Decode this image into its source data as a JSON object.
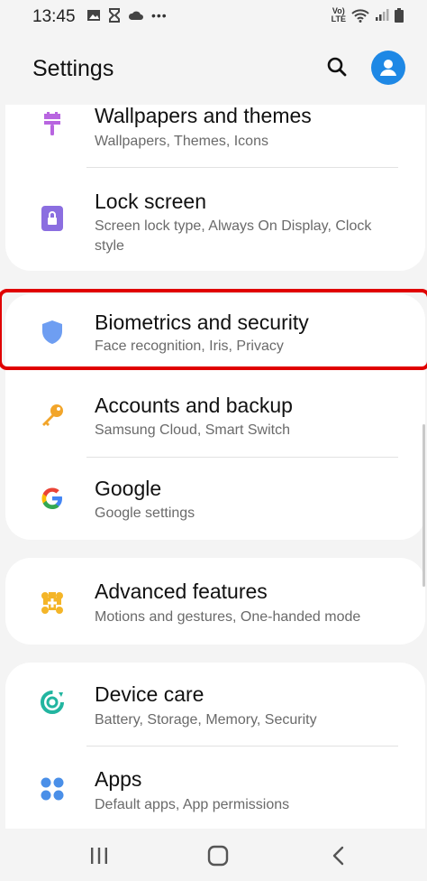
{
  "status": {
    "time": "13:45",
    "left_icons": [
      "image-icon",
      "hourglass-icon",
      "cloud-icon",
      "more-icon"
    ],
    "right_icons": [
      "volte-icon",
      "wifi-icon",
      "signal-icon",
      "battery-icon"
    ],
    "volte_text": "Vo)\nLTE"
  },
  "header": {
    "title": "Settings"
  },
  "items": [
    {
      "label": "Wallpapers and themes",
      "sub": "Wallpapers, Themes, Icons",
      "icon": "brush-icon",
      "color": "#b865e0"
    },
    {
      "label": "Lock screen",
      "sub": "Screen lock type, Always On Display, Clock style",
      "icon": "lock-icon",
      "color": "#8b6ee0"
    },
    {
      "label": "Biometrics and security",
      "sub": "Face recognition, Iris, Privacy",
      "icon": "shield-icon",
      "color": "#6e9ef2"
    },
    {
      "label": "Accounts and backup",
      "sub": "Samsung Cloud, Smart Switch",
      "icon": "key-icon",
      "color": "#f2a52a"
    },
    {
      "label": "Google",
      "sub": "Google settings",
      "icon": "google-icon",
      "color": "#4285f4"
    },
    {
      "label": "Advanced features",
      "sub": "Motions and gestures, One-handed mode",
      "icon": "plus-gear-icon",
      "color": "#f4b528"
    },
    {
      "label": "Device care",
      "sub": "Battery, Storage, Memory, Security",
      "icon": "device-care-icon",
      "color": "#22b5a0"
    },
    {
      "label": "Apps",
      "sub": "Default apps, App permissions",
      "icon": "apps-icon",
      "color": "#4a8fe8"
    }
  ],
  "nav": {
    "recent": "|||",
    "back": "<"
  }
}
